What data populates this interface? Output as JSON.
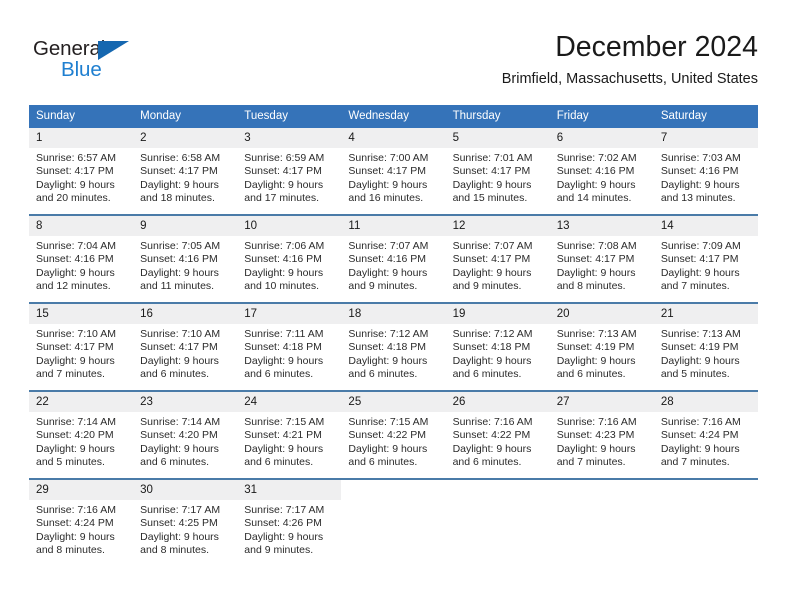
{
  "logo": {
    "text_primary": "General",
    "text_secondary": "Blue",
    "primary_color": "#231f20",
    "secondary_color": "#1f7fd0",
    "triangle_color": "#1567b0"
  },
  "header": {
    "title": "December 2024",
    "subtitle": "Brimfield, Massachusetts, United States"
  },
  "calendar": {
    "header_bg": "#3573b9",
    "header_text_color": "#ffffff",
    "daynum_bg": "#efeff0",
    "row_separator_color": "#4a7ba8",
    "weekday_headers": [
      "Sunday",
      "Monday",
      "Tuesday",
      "Wednesday",
      "Thursday",
      "Friday",
      "Saturday"
    ],
    "weeks": [
      [
        {
          "day": "1",
          "sunrise": "Sunrise: 6:57 AM",
          "sunset": "Sunset: 4:17 PM",
          "daylight_1": "Daylight: 9 hours",
          "daylight_2": "and 20 minutes."
        },
        {
          "day": "2",
          "sunrise": "Sunrise: 6:58 AM",
          "sunset": "Sunset: 4:17 PM",
          "daylight_1": "Daylight: 9 hours",
          "daylight_2": "and 18 minutes."
        },
        {
          "day": "3",
          "sunrise": "Sunrise: 6:59 AM",
          "sunset": "Sunset: 4:17 PM",
          "daylight_1": "Daylight: 9 hours",
          "daylight_2": "and 17 minutes."
        },
        {
          "day": "4",
          "sunrise": "Sunrise: 7:00 AM",
          "sunset": "Sunset: 4:17 PM",
          "daylight_1": "Daylight: 9 hours",
          "daylight_2": "and 16 minutes."
        },
        {
          "day": "5",
          "sunrise": "Sunrise: 7:01 AM",
          "sunset": "Sunset: 4:17 PM",
          "daylight_1": "Daylight: 9 hours",
          "daylight_2": "and 15 minutes."
        },
        {
          "day": "6",
          "sunrise": "Sunrise: 7:02 AM",
          "sunset": "Sunset: 4:16 PM",
          "daylight_1": "Daylight: 9 hours",
          "daylight_2": "and 14 minutes."
        },
        {
          "day": "7",
          "sunrise": "Sunrise: 7:03 AM",
          "sunset": "Sunset: 4:16 PM",
          "daylight_1": "Daylight: 9 hours",
          "daylight_2": "and 13 minutes."
        }
      ],
      [
        {
          "day": "8",
          "sunrise": "Sunrise: 7:04 AM",
          "sunset": "Sunset: 4:16 PM",
          "daylight_1": "Daylight: 9 hours",
          "daylight_2": "and 12 minutes."
        },
        {
          "day": "9",
          "sunrise": "Sunrise: 7:05 AM",
          "sunset": "Sunset: 4:16 PM",
          "daylight_1": "Daylight: 9 hours",
          "daylight_2": "and 11 minutes."
        },
        {
          "day": "10",
          "sunrise": "Sunrise: 7:06 AM",
          "sunset": "Sunset: 4:16 PM",
          "daylight_1": "Daylight: 9 hours",
          "daylight_2": "and 10 minutes."
        },
        {
          "day": "11",
          "sunrise": "Sunrise: 7:07 AM",
          "sunset": "Sunset: 4:16 PM",
          "daylight_1": "Daylight: 9 hours",
          "daylight_2": "and 9 minutes."
        },
        {
          "day": "12",
          "sunrise": "Sunrise: 7:07 AM",
          "sunset": "Sunset: 4:17 PM",
          "daylight_1": "Daylight: 9 hours",
          "daylight_2": "and 9 minutes."
        },
        {
          "day": "13",
          "sunrise": "Sunrise: 7:08 AM",
          "sunset": "Sunset: 4:17 PM",
          "daylight_1": "Daylight: 9 hours",
          "daylight_2": "and 8 minutes."
        },
        {
          "day": "14",
          "sunrise": "Sunrise: 7:09 AM",
          "sunset": "Sunset: 4:17 PM",
          "daylight_1": "Daylight: 9 hours",
          "daylight_2": "and 7 minutes."
        }
      ],
      [
        {
          "day": "15",
          "sunrise": "Sunrise: 7:10 AM",
          "sunset": "Sunset: 4:17 PM",
          "daylight_1": "Daylight: 9 hours",
          "daylight_2": "and 7 minutes."
        },
        {
          "day": "16",
          "sunrise": "Sunrise: 7:10 AM",
          "sunset": "Sunset: 4:17 PM",
          "daylight_1": "Daylight: 9 hours",
          "daylight_2": "and 6 minutes."
        },
        {
          "day": "17",
          "sunrise": "Sunrise: 7:11 AM",
          "sunset": "Sunset: 4:18 PM",
          "daylight_1": "Daylight: 9 hours",
          "daylight_2": "and 6 minutes."
        },
        {
          "day": "18",
          "sunrise": "Sunrise: 7:12 AM",
          "sunset": "Sunset: 4:18 PM",
          "daylight_1": "Daylight: 9 hours",
          "daylight_2": "and 6 minutes."
        },
        {
          "day": "19",
          "sunrise": "Sunrise: 7:12 AM",
          "sunset": "Sunset: 4:18 PM",
          "daylight_1": "Daylight: 9 hours",
          "daylight_2": "and 6 minutes."
        },
        {
          "day": "20",
          "sunrise": "Sunrise: 7:13 AM",
          "sunset": "Sunset: 4:19 PM",
          "daylight_1": "Daylight: 9 hours",
          "daylight_2": "and 6 minutes."
        },
        {
          "day": "21",
          "sunrise": "Sunrise: 7:13 AM",
          "sunset": "Sunset: 4:19 PM",
          "daylight_1": "Daylight: 9 hours",
          "daylight_2": "and 5 minutes."
        }
      ],
      [
        {
          "day": "22",
          "sunrise": "Sunrise: 7:14 AM",
          "sunset": "Sunset: 4:20 PM",
          "daylight_1": "Daylight: 9 hours",
          "daylight_2": "and 5 minutes."
        },
        {
          "day": "23",
          "sunrise": "Sunrise: 7:14 AM",
          "sunset": "Sunset: 4:20 PM",
          "daylight_1": "Daylight: 9 hours",
          "daylight_2": "and 6 minutes."
        },
        {
          "day": "24",
          "sunrise": "Sunrise: 7:15 AM",
          "sunset": "Sunset: 4:21 PM",
          "daylight_1": "Daylight: 9 hours",
          "daylight_2": "and 6 minutes."
        },
        {
          "day": "25",
          "sunrise": "Sunrise: 7:15 AM",
          "sunset": "Sunset: 4:22 PM",
          "daylight_1": "Daylight: 9 hours",
          "daylight_2": "and 6 minutes."
        },
        {
          "day": "26",
          "sunrise": "Sunrise: 7:16 AM",
          "sunset": "Sunset: 4:22 PM",
          "daylight_1": "Daylight: 9 hours",
          "daylight_2": "and 6 minutes."
        },
        {
          "day": "27",
          "sunrise": "Sunrise: 7:16 AM",
          "sunset": "Sunset: 4:23 PM",
          "daylight_1": "Daylight: 9 hours",
          "daylight_2": "and 7 minutes."
        },
        {
          "day": "28",
          "sunrise": "Sunrise: 7:16 AM",
          "sunset": "Sunset: 4:24 PM",
          "daylight_1": "Daylight: 9 hours",
          "daylight_2": "and 7 minutes."
        }
      ],
      [
        {
          "day": "29",
          "sunrise": "Sunrise: 7:16 AM",
          "sunset": "Sunset: 4:24 PM",
          "daylight_1": "Daylight: 9 hours",
          "daylight_2": "and 8 minutes."
        },
        {
          "day": "30",
          "sunrise": "Sunrise: 7:17 AM",
          "sunset": "Sunset: 4:25 PM",
          "daylight_1": "Daylight: 9 hours",
          "daylight_2": "and 8 minutes."
        },
        {
          "day": "31",
          "sunrise": "Sunrise: 7:17 AM",
          "sunset": "Sunset: 4:26 PM",
          "daylight_1": "Daylight: 9 hours",
          "daylight_2": "and 9 minutes."
        },
        {
          "day": "",
          "sunrise": "",
          "sunset": "",
          "daylight_1": "",
          "daylight_2": ""
        },
        {
          "day": "",
          "sunrise": "",
          "sunset": "",
          "daylight_1": "",
          "daylight_2": ""
        },
        {
          "day": "",
          "sunrise": "",
          "sunset": "",
          "daylight_1": "",
          "daylight_2": ""
        },
        {
          "day": "",
          "sunrise": "",
          "sunset": "",
          "daylight_1": "",
          "daylight_2": ""
        }
      ]
    ]
  }
}
